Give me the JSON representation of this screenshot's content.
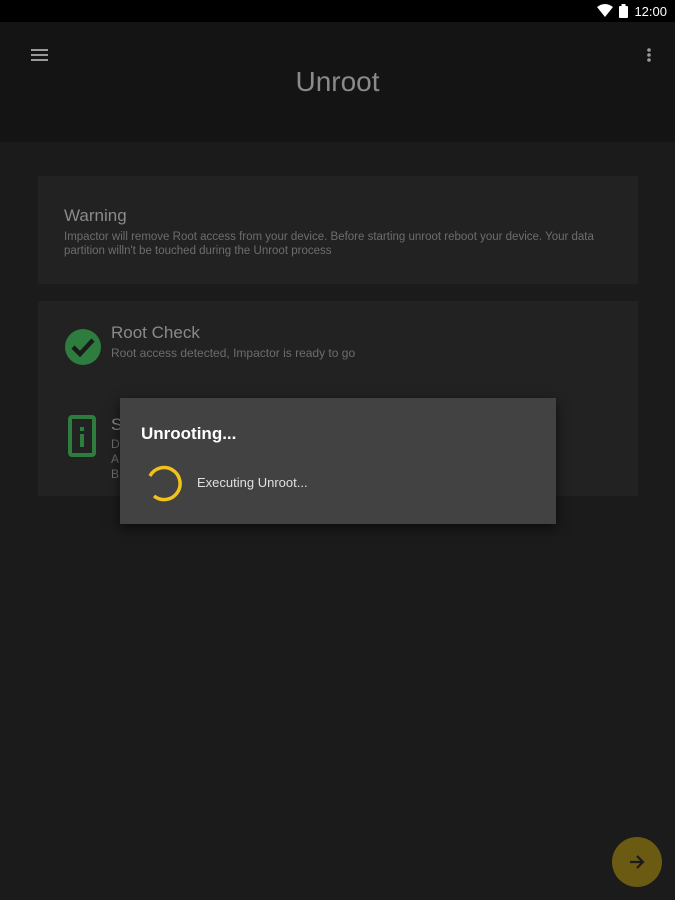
{
  "status_bar": {
    "time": "12:00",
    "icons": [
      "wifi-icon",
      "battery-icon"
    ]
  },
  "app_bar": {
    "title": "Unroot",
    "menu_icon": "menu-icon",
    "more_icon": "more-vert-icon"
  },
  "warning_card": {
    "title": "Warning",
    "body": "Impactor will remove Root access from your device. Before starting unroot reboot your device. Your data partition willn't be touched during the Unroot process"
  },
  "checks_card": {
    "root_check": {
      "title": "Root Check",
      "subtitle": "Root access detected, Impactor is ready to go",
      "icon": "check-circle-icon"
    },
    "system_info": {
      "title": "S",
      "lines": [
        "D",
        "A",
        "B"
      ],
      "icon": "info-icon"
    }
  },
  "dialog": {
    "title": "Unrooting...",
    "message": "Executing Unroot..."
  },
  "fab": {
    "icon": "arrow-right-icon"
  },
  "colors": {
    "accent": "#f2c21b",
    "success": "#2e9e4a",
    "fab": "#6b5a12"
  }
}
